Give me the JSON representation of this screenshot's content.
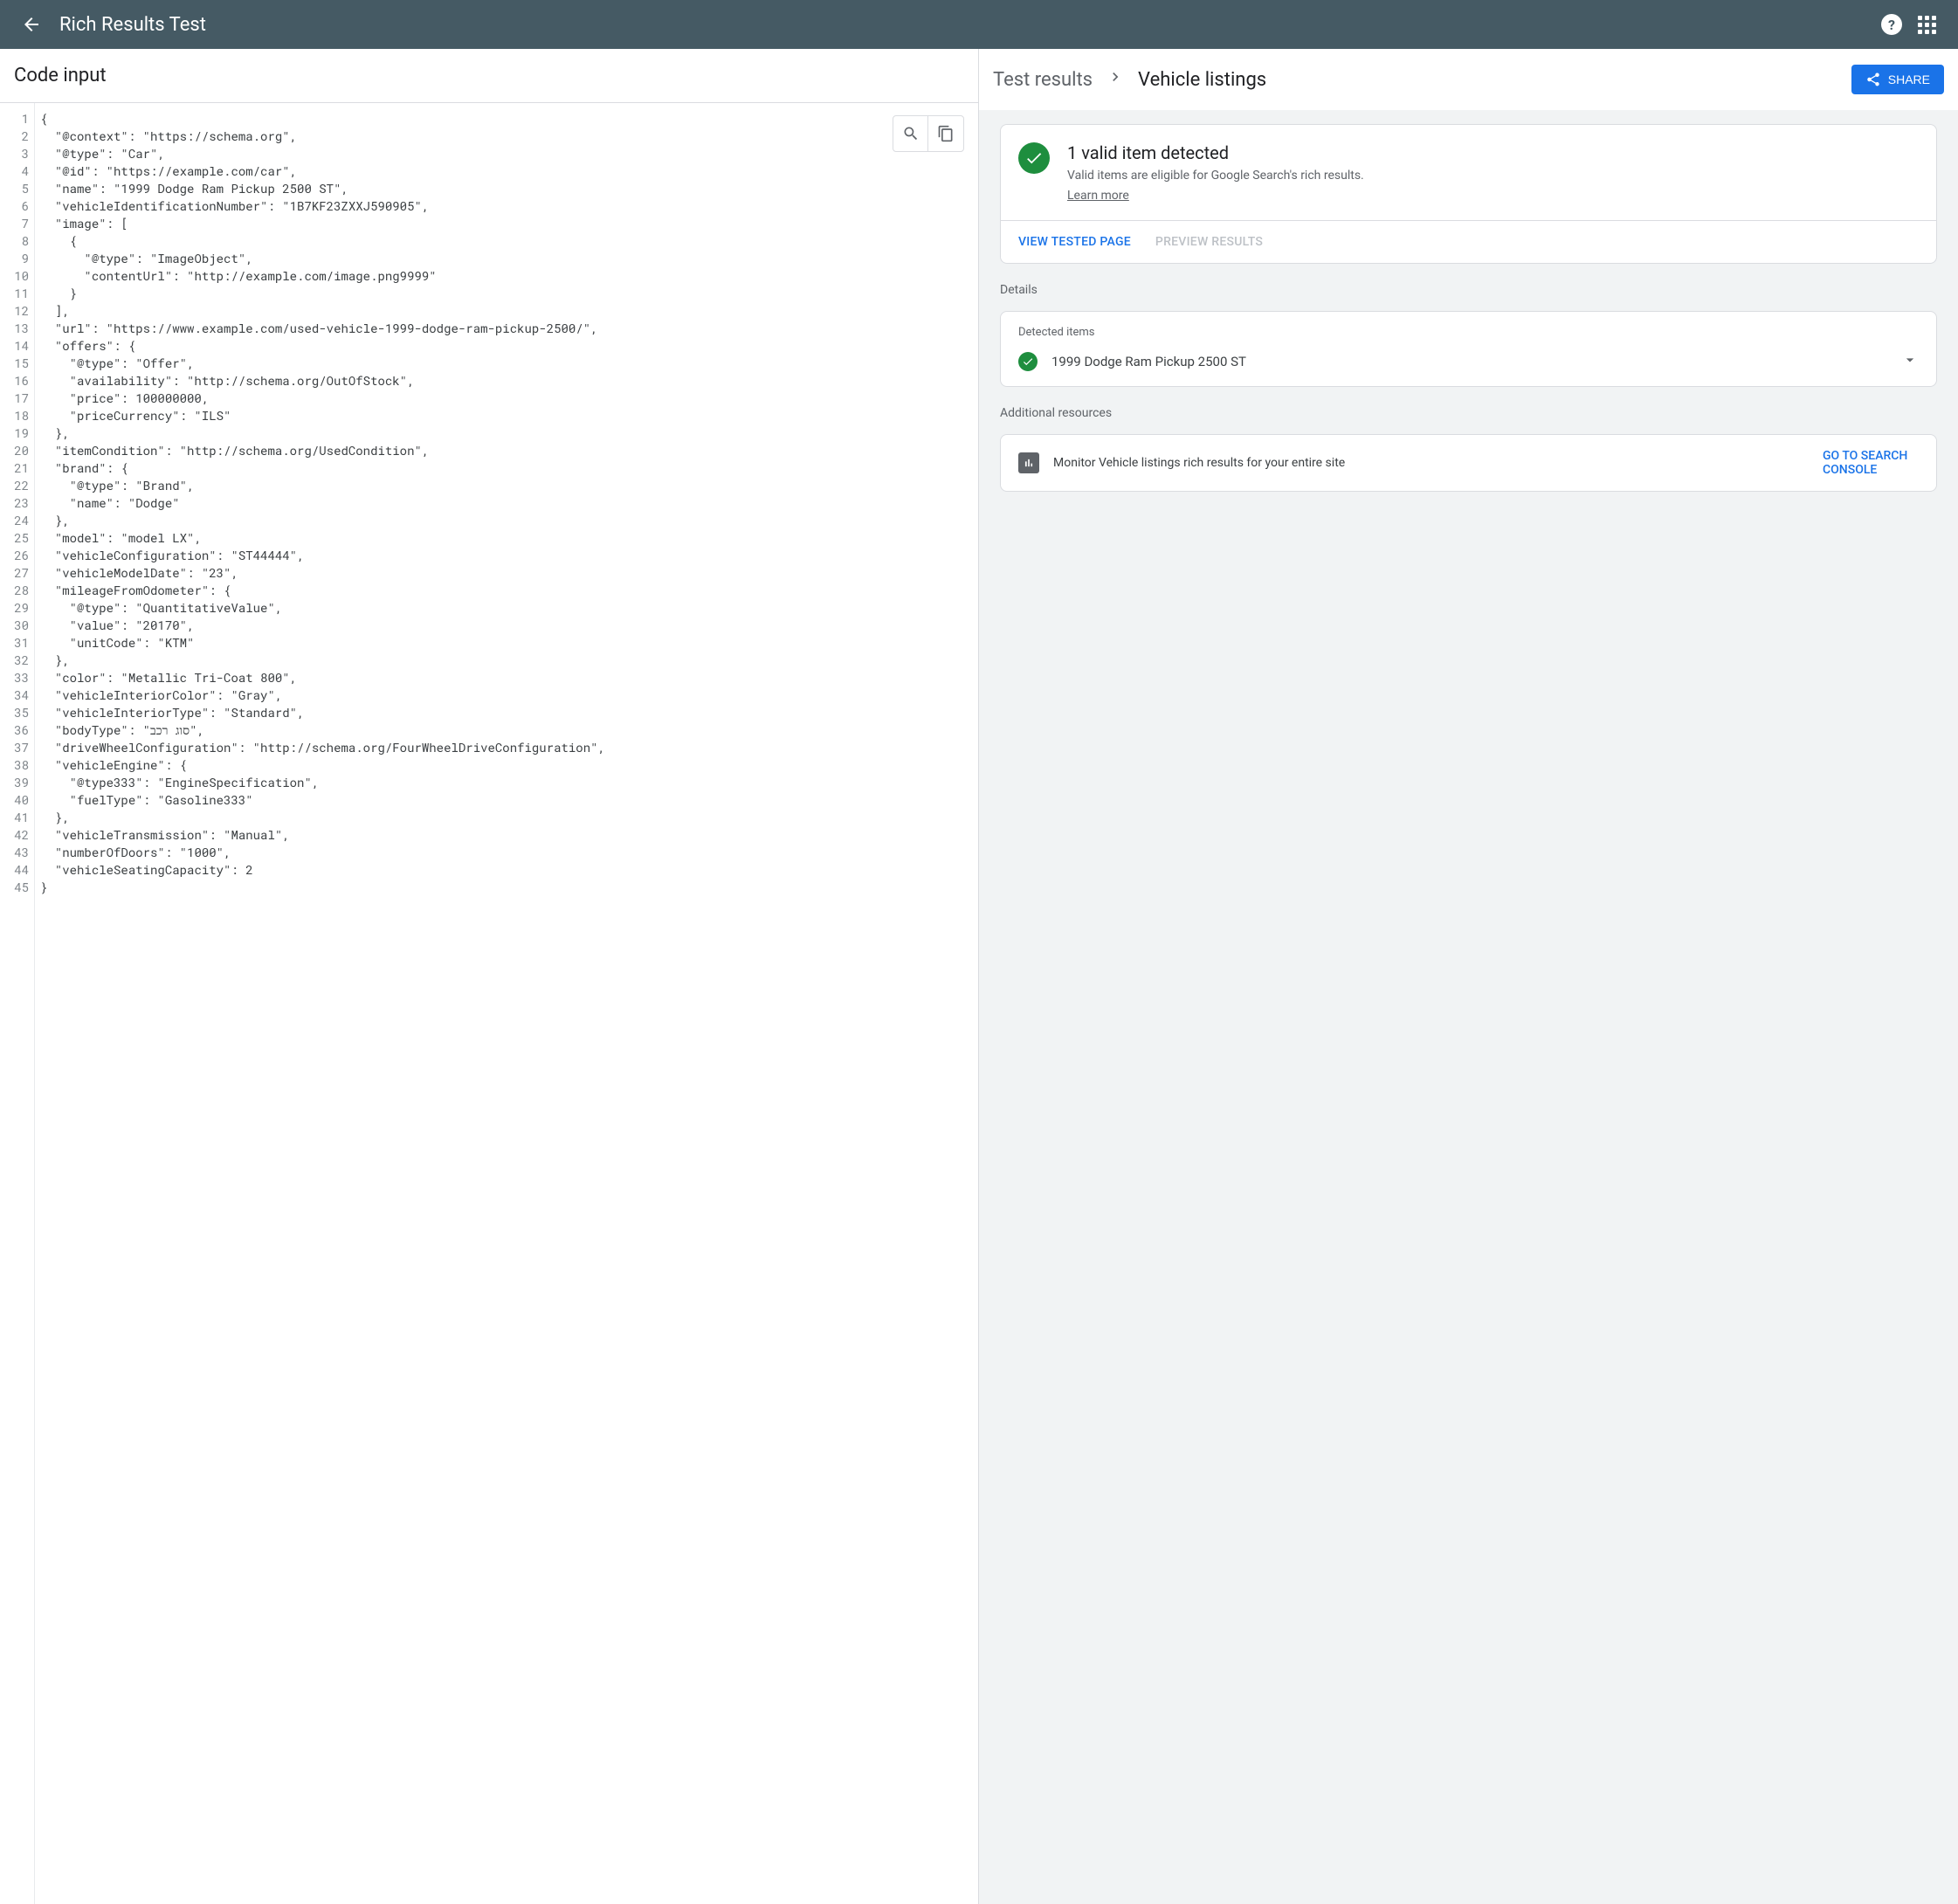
{
  "header": {
    "title": "Rich Results Test"
  },
  "left": {
    "heading": "Code input",
    "code_lines": [
      "{",
      "  \"@context\": \"https://schema.org\",",
      "  \"@type\": \"Car\",",
      "  \"@id\": \"https://example.com/car\",",
      "  \"name\": \"1999 Dodge Ram Pickup 2500 ST\",",
      "  \"vehicleIdentificationNumber\": \"1B7KF23ZXXJ590905\",",
      "  \"image\": [",
      "    {",
      "      \"@type\": \"ImageObject\",",
      "      \"contentUrl\": \"http://example.com/image.png9999\"",
      "    }",
      "  ],",
      "  \"url\": \"https://www.example.com/used-vehicle-1999-dodge-ram-pickup-2500/\",",
      "  \"offers\": {",
      "    \"@type\": \"Offer\",",
      "    \"availability\": \"http://schema.org/OutOfStock\",",
      "    \"price\": 100000000,",
      "    \"priceCurrency\": \"ILS\"",
      "  },",
      "  \"itemCondition\": \"http://schema.org/UsedCondition\",",
      "  \"brand\": {",
      "    \"@type\": \"Brand\",",
      "    \"name\": \"Dodge\"",
      "  },",
      "  \"model\": \"model LX\",",
      "  \"vehicleConfiguration\": \"ST44444\",",
      "  \"vehicleModelDate\": \"23\",",
      "  \"mileageFromOdometer\": {",
      "    \"@type\": \"QuantitativeValue\",",
      "    \"value\": \"20170\",",
      "    \"unitCode\": \"KTM\"",
      "  },",
      "  \"color\": \"Metallic Tri-Coat 800\",",
      "  \"vehicleInteriorColor\": \"Gray\",",
      "  \"vehicleInteriorType\": \"Standard\",",
      "  \"bodyType\": \"סוג רכב\",",
      "  \"driveWheelConfiguration\": \"http://schema.org/FourWheelDriveConfiguration\",",
      "  \"vehicleEngine\": {",
      "    \"@type333\": \"EngineSpecification\",",
      "    \"fuelType\": \"Gasoline333\"",
      "  },",
      "  \"vehicleTransmission\": \"Manual\",",
      "  \"numberOfDoors\": \"1000\",",
      "  \"vehicleSeatingCapacity\": 2",
      "}"
    ]
  },
  "right": {
    "breadcrumb_root": "Test results",
    "breadcrumb_current": "Vehicle listings",
    "share_label": "SHARE",
    "status": {
      "title": "1 valid item detected",
      "desc": "Valid items are eligible for Google Search's rich results.",
      "learn": "Learn more"
    },
    "tabs": {
      "view": "VIEW TESTED PAGE",
      "preview": "PREVIEW RESULTS"
    },
    "details_label": "Details",
    "detected": {
      "heading": "Detected items",
      "item_name": "1999 Dodge Ram Pickup 2500 ST"
    },
    "resources_label": "Additional resources",
    "resource": {
      "text": "Monitor Vehicle listings rich results for your entire site",
      "link": "GO TO SEARCH CONSOLE"
    }
  }
}
